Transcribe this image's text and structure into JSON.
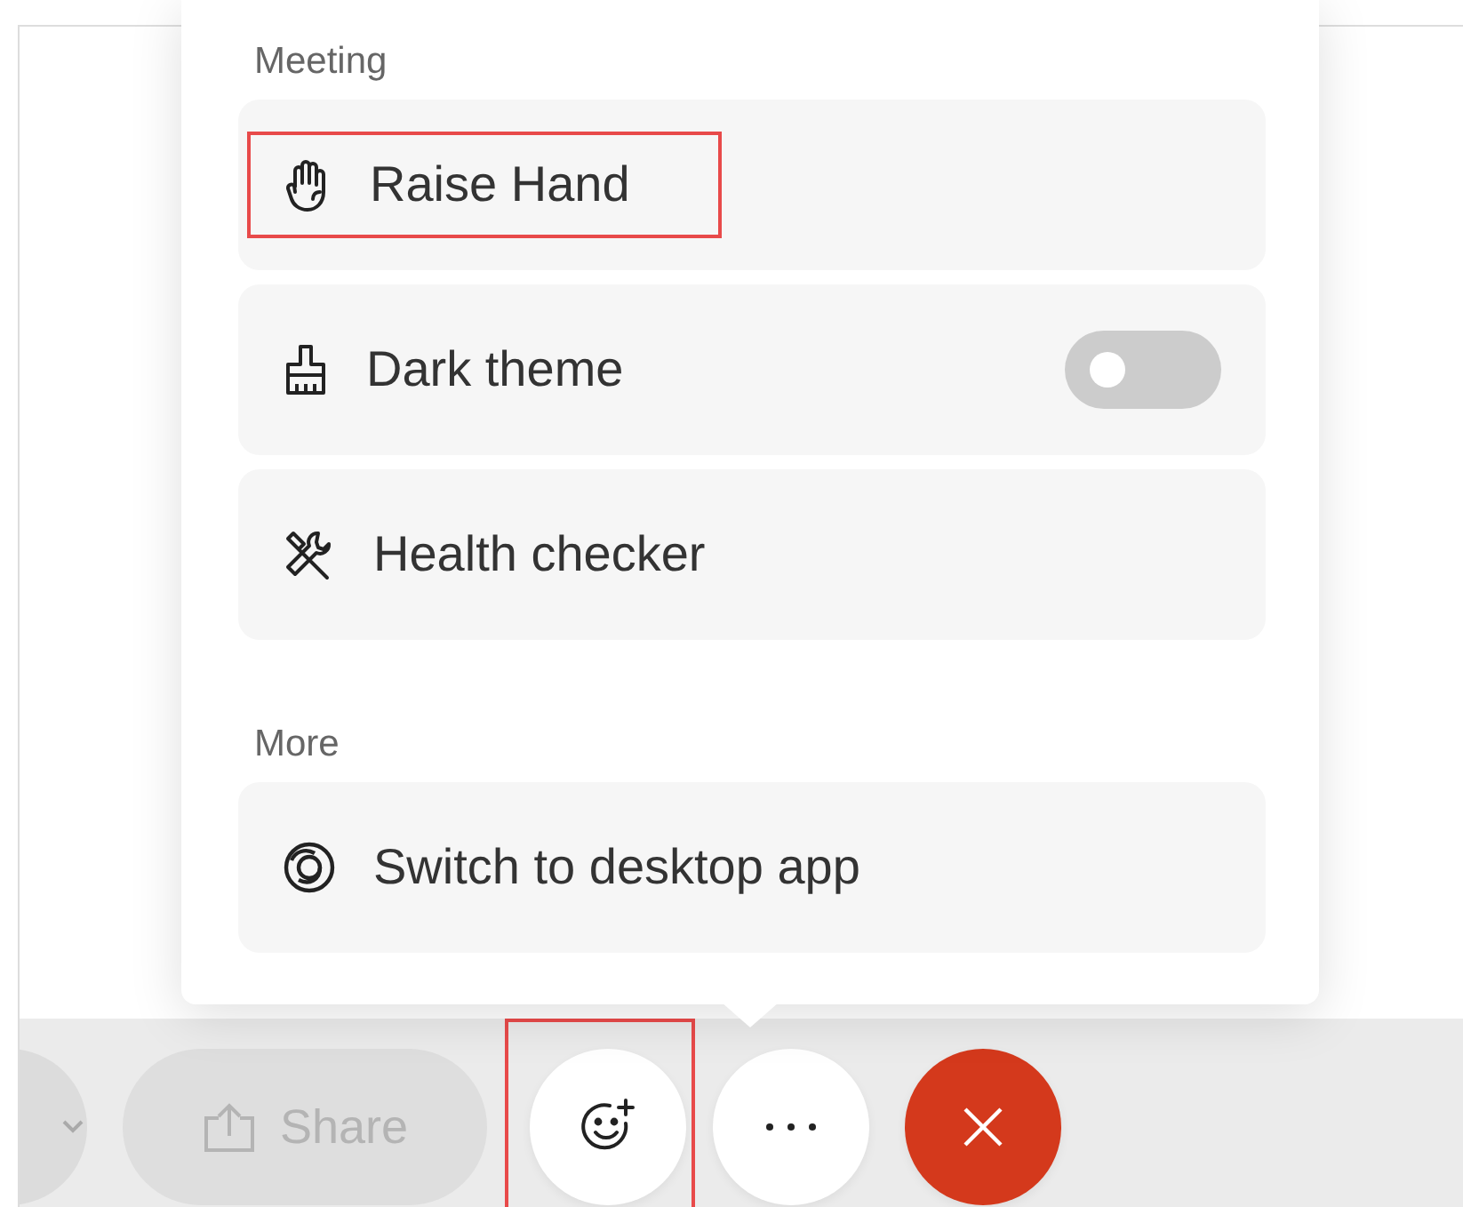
{
  "menu": {
    "sections": [
      {
        "title": "Meeting",
        "items": [
          {
            "kind": "action",
            "label": "Raise Hand",
            "highlighted": true
          },
          {
            "kind": "toggle",
            "label": "Dark theme",
            "on": false,
            "highlighted": false
          },
          {
            "kind": "action",
            "label": "Health checker",
            "highlighted": false
          }
        ]
      },
      {
        "title": "More",
        "items": [
          {
            "kind": "action",
            "label": "Switch to desktop app",
            "highlighted": false
          }
        ]
      }
    ]
  },
  "toolbar": {
    "buttons": [
      {
        "kind": "partial",
        "highlighted": false
      },
      {
        "kind": "share",
        "label": "Share",
        "disabled": true,
        "highlighted": false
      },
      {
        "kind": "reaction",
        "highlighted": true
      },
      {
        "kind": "more",
        "highlighted": false
      },
      {
        "kind": "end",
        "highlighted": false
      }
    ]
  }
}
